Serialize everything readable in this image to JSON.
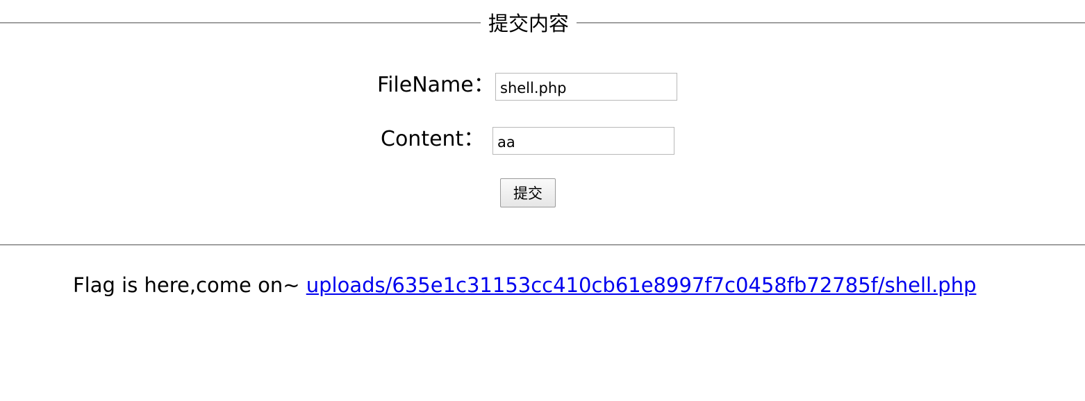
{
  "form": {
    "legend": "提交内容",
    "filename_label": "FileName：",
    "filename_value": "shell.php",
    "content_label": "Content：",
    "content_value": "aa",
    "submit_label": "提交"
  },
  "result": {
    "prefix": "Flag is here,come on~ ",
    "link_text": "uploads/635e1c31153cc410cb61e8997f7c0458fb72785f/shell.php",
    "link_color": "#0000ee"
  }
}
